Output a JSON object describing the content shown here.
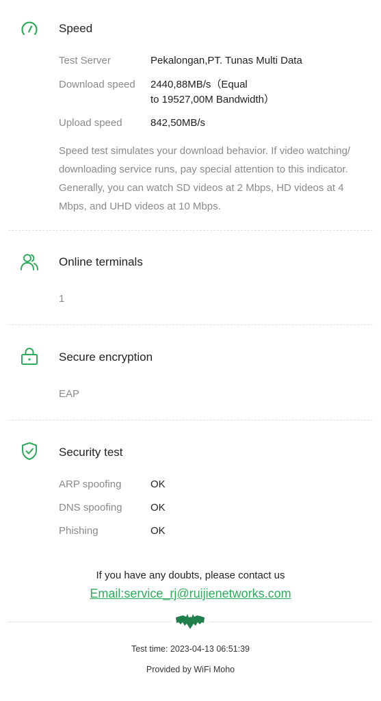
{
  "colors": {
    "accent": "#2eab5a",
    "muted": "#8a8a8a",
    "text": "#1f1f1f"
  },
  "speed": {
    "icon": "speedometer-icon",
    "title": "Speed",
    "rows": [
      {
        "label": "Test Server",
        "value": "Pekalongan,PT. Tunas Multi Data"
      },
      {
        "label": "Download speed",
        "value_line1": "2440,88MB/s（Equal",
        "value_line2": "to 19527,00M Bandwidth）"
      },
      {
        "label": "Upload speed",
        "value": "842,50MB/s"
      }
    ],
    "desc_lines": [
      "Speed test simulates your download behavior. If video watching/",
      "downloading service runs, pay special attention to this indicator.",
      "Generally, you can watch SD videos at 2 Mbps, HD videos at 4",
      "Mbps, and UHD videos at 10 Mbps."
    ]
  },
  "terminals": {
    "icon": "users-icon",
    "title": "Online terminals",
    "value": "1"
  },
  "encryption": {
    "icon": "lock-icon",
    "title": "Secure encryption",
    "value": "EAP"
  },
  "security": {
    "icon": "shield-check-icon",
    "title": "Security test",
    "rows": [
      {
        "label": "ARP spoofing",
        "value": "OK"
      },
      {
        "label": "DNS spoofing",
        "value": "OK"
      },
      {
        "label": "Phishing",
        "value": "OK"
      }
    ]
  },
  "contact": {
    "text": "If you have any doubts, please contact us",
    "email": "Email:service_rj@ruijienetworks.com"
  },
  "footer": {
    "logo": "bat-logo-icon",
    "test_time": "Test time: 2023-04-13 06:51:39",
    "provided_by": "Provided by WiFi Moho"
  }
}
